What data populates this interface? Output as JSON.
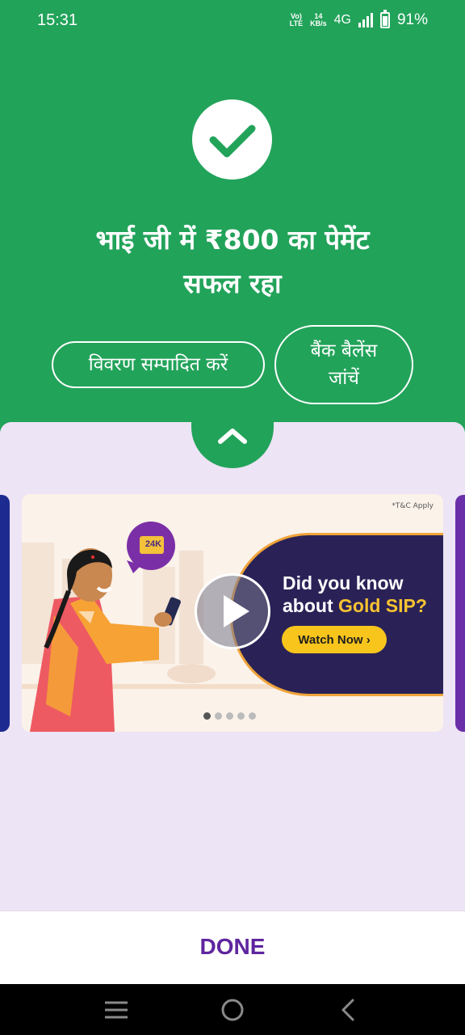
{
  "status_bar": {
    "time": "15:31",
    "volte_top": "Vo)",
    "volte_bottom": "LTE",
    "speed_value": "14",
    "speed_unit": "KB/s",
    "network": "4G",
    "battery": "91%"
  },
  "result": {
    "title_line1": "भाई जी में ₹800 का पेमेंट",
    "title_line2": "सफल रहा",
    "edit_details_label": "विवरण सम्पादित करें",
    "check_balance_line1": "बैंक बैलेंस",
    "check_balance_line2": "जांचें"
  },
  "banner": {
    "tnc": "*T&C Apply",
    "gold_badge": "24K",
    "line1": "Did you know",
    "line2_prefix": "about ",
    "line2_highlight": "Gold SIP?",
    "cta": "Watch Now ›",
    "page_count": 5,
    "active_page": 1
  },
  "footer": {
    "done_label": "DONE"
  },
  "colors": {
    "success_green": "#22a35a",
    "brand_purple": "#5f259f",
    "sheet_bg": "#ede4f5",
    "banner_navy": "#2a2257",
    "cta_yellow": "#f8c51c"
  },
  "icons": [
    "check-icon",
    "chevron-up-icon",
    "play-icon",
    "menu-icon",
    "home-icon",
    "back-icon"
  ]
}
